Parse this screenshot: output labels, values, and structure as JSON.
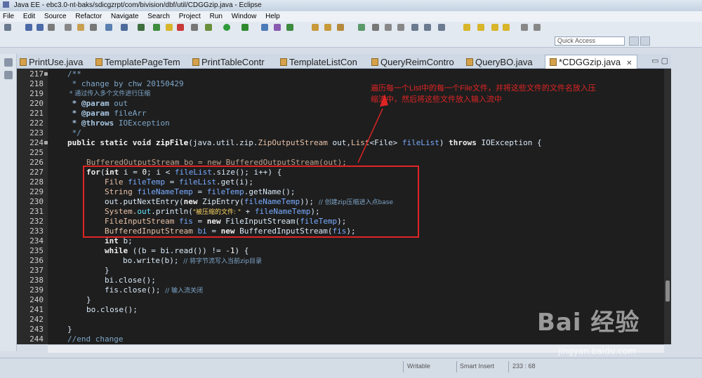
{
  "window": {
    "title": "Java EE - ebc3.0-nt-baks/sdicgzrpt/com/bivision/dbf/util/CDGGzip.java - Eclipse"
  },
  "menu": [
    "File",
    "Edit",
    "Source",
    "Refactor",
    "Navigate",
    "Search",
    "Project",
    "Run",
    "Window",
    "Help"
  ],
  "quick_access": {
    "placeholder": "Quick Access"
  },
  "tabs": [
    "PrintUse.java",
    "TemplatePageTem",
    "PrintTableContr",
    "TemplateListCon",
    "QueryReimContro",
    "QueryBO.java",
    "*CDGGzip.java"
  ],
  "tab_active_index": 6,
  "line_numbers": [
    "217",
    "218",
    "219",
    "220",
    "221",
    "222",
    "223",
    "224",
    "225",
    "226",
    "227",
    "228",
    "229",
    "230",
    "231",
    "232",
    "233",
    "234",
    "235",
    "236",
    "237",
    "238",
    "239",
    "240",
    "241",
    "242",
    "243",
    "244"
  ],
  "code": {
    "l217": "/**",
    "l218": " * change by chw 20150429",
    "l219": " * 通过传入多个文件进行压缩",
    "l220a": " * @param",
    "l220b": " out",
    "l221a": " * @param",
    "l221b": " fileArr",
    "l222a": " * @throws",
    "l222b": " IOException",
    "l223": " */",
    "l224": {
      "kw": "public static void ",
      "name": "zipFile",
      "p1": "(java.util.zip.",
      "cls": "ZipOutputStream",
      "p2": " out,",
      "cls2": "List",
      "p3": "<File> ",
      "var": "fileList",
      "p4": ") ",
      "kw2": "throws",
      "p5": " IOException {"
    },
    "l226": "BufferedOutputStream bo = new BufferedOutputStream(out);",
    "l227": {
      "kw": "for",
      "a": "(",
      "kw2": "int",
      "b": " i = ",
      "n": "0",
      "c": "; i < ",
      "v": "fileList",
      "d": ".size(); i++) {"
    },
    "l228": {
      "a": "File ",
      "v": "fileTemp",
      "b": " = ",
      "v2": "fileList",
      "c": ".get(i);"
    },
    "l229": {
      "a": "String ",
      "v": "fileNameTemp",
      "b": " = ",
      "v2": "fileTemp",
      "c": ".getName();"
    },
    "l230": {
      "a": "out.putNextEntry(",
      "kw": "new",
      "b": " ZipEntry(",
      "v": "fileNameTemp",
      "c": ")); ",
      "cm": "// 创建zip压缩进入点base"
    },
    "l231": {
      "a": "System.",
      "f": "out",
      "b": ".println(",
      "s": "\"被压缩的文件: \"",
      "c": " + ",
      "v": "fileNameTemp",
      "d": ");"
    },
    "l232": {
      "a": "FileInputStream ",
      "v": "fis",
      "b": " = ",
      "kw": "new",
      "c": " FileInputStream(",
      "v2": "fileTemp",
      "d": ");"
    },
    "l233": {
      "a": "BufferedInputStream ",
      "v": "bi",
      "b": " = ",
      "kw": "new",
      "c": " BufferedInputStream(",
      "v2": "fis",
      "d": ");"
    },
    "l234": {
      "kw": "int",
      "a": " b;"
    },
    "l235": {
      "kw": "while",
      "a": " ((b = bi.read()) != -",
      "n": "1",
      "b": ") {"
    },
    "l236": {
      "a": "bo.write(b); ",
      "cm": "// 将字节流写入当前zip目录"
    },
    "l237": "}",
    "l238": "bi.close();",
    "l239": {
      "a": "fis.close(); ",
      "cm": "// 输入流关闭"
    },
    "l240": "}",
    "l241": "bo.close();",
    "l243": "}",
    "l244": "//end change"
  },
  "annotation": "遍历每一个List中的每一个File文件，并将这些文件的文件名放入压缩流中，然后将这些文件放入输入流中",
  "status": {
    "writable": "Writable",
    "insert": "Smart Insert",
    "pos": "233 : 68"
  },
  "watermark": {
    "brand": "Bai 经验",
    "url": "jingyan.baidu.com"
  }
}
